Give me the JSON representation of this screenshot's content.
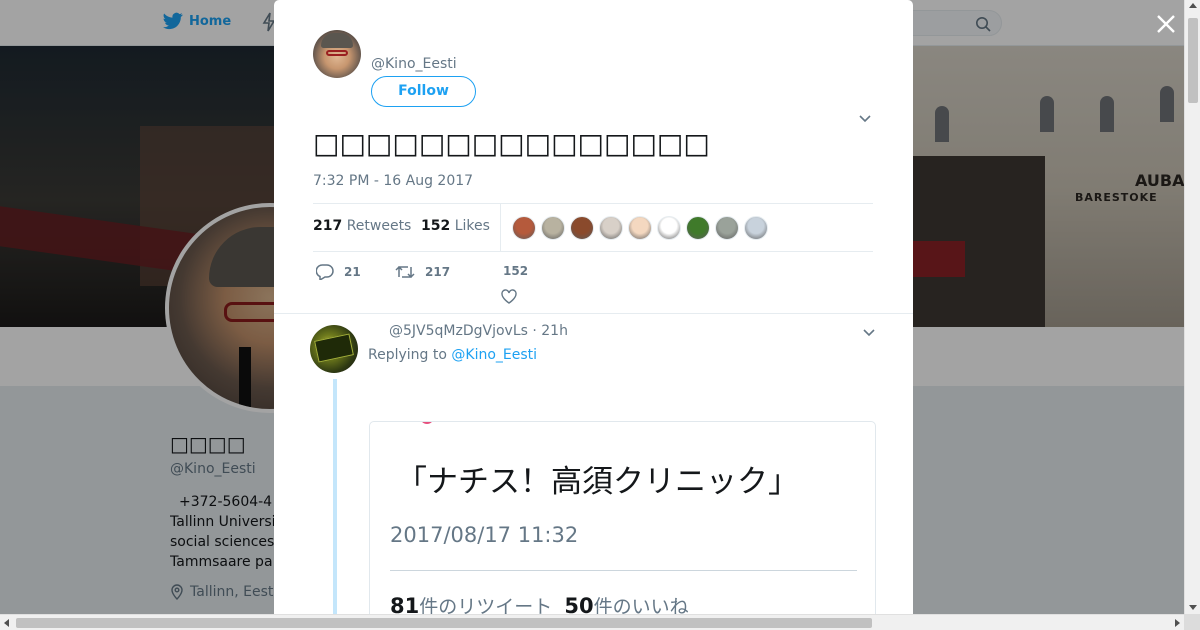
{
  "nav": {
    "home_label": "Home",
    "home_icon": "twitter-bird-icon",
    "moments_icon": "lightning-icon",
    "search_icon": "search-icon"
  },
  "banner": {
    "sign_text": "AUBAS",
    "shop_text": "BARESTOKE"
  },
  "profile": {
    "name": "□□□□",
    "handle": "@Kino_Eesti",
    "bio_lines": [
      "+372-5604-4",
      "Tallinn Universi",
      "social sciences",
      "Tammsaare pa"
    ],
    "location": "Tallinn, Eest"
  },
  "tweet": {
    "handle": "@Kino_Eesti",
    "follow_label": "Follow",
    "text": "□□□□□□□□□□□□□□□",
    "timestamp": "7:32 PM - 16 Aug 2017",
    "retweets_count": "217",
    "retweets_label": "Retweets",
    "likes_count": "152",
    "likes_label": "Likes",
    "liker_colors": [
      "#b55a3c",
      "#b8b2a0",
      "#8a4a2c",
      "#d8d0c8",
      "#f4d8c0",
      "#ffffff",
      "#3f7a2a",
      "#9aa29a",
      "#c8d2dc"
    ],
    "actions": {
      "reply_count": "21",
      "retweet_count": "217",
      "like_count": "152"
    }
  },
  "reply": {
    "handle_time": "@5JV5qMzDgVjovLs · 21h",
    "replying_prefix": "Replying to",
    "replying_to": "@Kino_Eesti",
    "media": {
      "title": "「ナチス！高須クリニック」",
      "timestamp": "2017/08/17 11:32",
      "retweets_num": "81",
      "retweets_text": "件のリツイート",
      "likes_num": "50",
      "likes_text": "件のいいね"
    }
  },
  "colors": {
    "accent": "#1da1f2",
    "text": "#14171a",
    "muted": "#657786",
    "thread": "#c4e6fb"
  }
}
